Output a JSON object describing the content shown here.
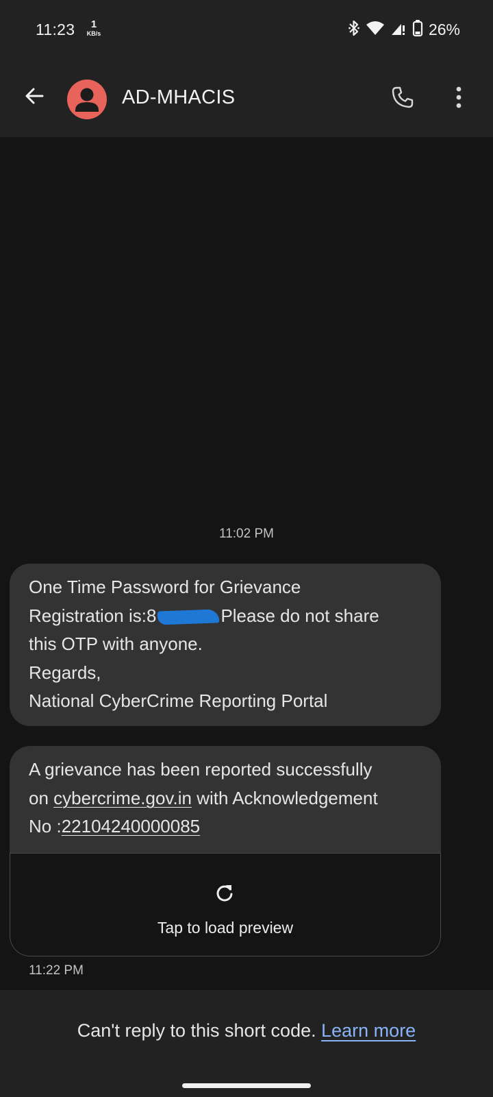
{
  "status_bar": {
    "time": "11:23",
    "net_speed_value": "1",
    "net_speed_unit": "KB/s",
    "battery_percent": "26%",
    "icons": [
      "bluetooth-icon",
      "wifi-icon",
      "cell-signal-icon",
      "battery-icon"
    ]
  },
  "header": {
    "contact_name": "AD-MHACIS",
    "avatar_color": "#e8645a",
    "icons": [
      "back-arrow-icon",
      "phone-icon",
      "more-vert-icon"
    ]
  },
  "conversation": {
    "first_timestamp": "11:02 PM",
    "message_1": {
      "line_1": "One Time Password for Grievance",
      "line_2_prefix": "Registration is:",
      "line_2_redacted_visible": "8",
      "line_2_suffix": "Please do not share",
      "line_3": "this OTP with anyone.",
      "line_4": "Regards,",
      "line_5": "National CyberCrime Reporting Portal"
    },
    "message_2": {
      "line_1": "A grievance has been reported successfully",
      "line_2_prefix": "on ",
      "line_2_link": "cybercrime.gov.in",
      "line_2_suffix": " with Acknowledgement",
      "line_3_prefix": "No :",
      "line_3_link": "22104240000085",
      "preview_label": "Tap to load preview",
      "preview_icon": "refresh-icon"
    },
    "last_timestamp": "11:22 PM"
  },
  "footer": {
    "notice": "Can't reply to this short code.",
    "learn_more": "Learn more"
  },
  "colors": {
    "background": "#141414",
    "bar": "#222222",
    "bubble": "#333333",
    "link_accent": "#8ab4f8",
    "redaction": "#1f78d6"
  }
}
